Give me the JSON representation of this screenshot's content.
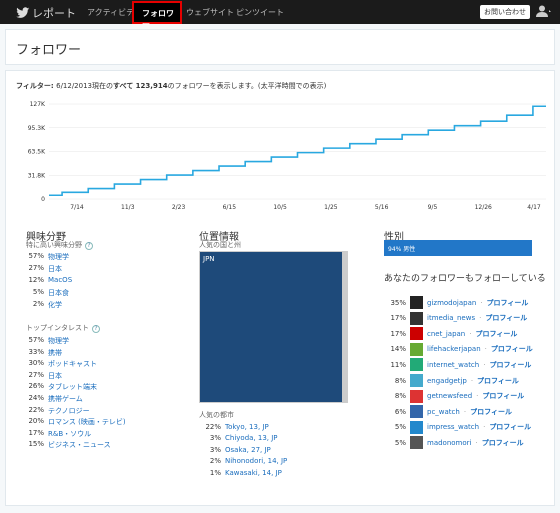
{
  "topbar": {
    "brand": "レポート",
    "nav": [
      "アクティビティ",
      "フォロワー",
      "ウェブサイト",
      "ピンツイート"
    ],
    "contact": "お問い合わせ"
  },
  "page_title": "フォロワー",
  "filter": {
    "label": "フィルター: ",
    "text_before": "6/12/2013現在の",
    "bold": "すべて 123,914",
    "text_after": "のフォロワーを表示します。(太平洋時間での表示)"
  },
  "chart_data": {
    "type": "line",
    "y_ticks": [
      "127K",
      "95.3K",
      "63.5K",
      "31.8K",
      "0"
    ],
    "x_ticks": [
      "7/14",
      "11/3",
      "2/23",
      "6/15",
      "10/5",
      "1/25",
      "5/16",
      "9/5",
      "12/26",
      "4/17"
    ],
    "ylim": [
      0,
      127000
    ],
    "color": "#29a8e0",
    "series": [
      {
        "values": [
          5000,
          9000,
          14000,
          20000,
          26000,
          32000,
          38000,
          44000,
          50000,
          56000,
          62000,
          68000,
          74000,
          80000,
          86000,
          92000,
          98000,
          104000,
          112000,
          124000
        ]
      }
    ]
  },
  "interests": {
    "title": "興味分野",
    "subtitle": "特に高い興味分野",
    "items": [
      {
        "pct": "57%",
        "label": "物理学"
      },
      {
        "pct": "27%",
        "label": "日本"
      },
      {
        "pct": "12%",
        "label": "MacOS"
      },
      {
        "pct": "5%",
        "label": "日本食"
      },
      {
        "pct": "2%",
        "label": "化学"
      }
    ],
    "top_title": "トップインタレスト",
    "top_items": [
      {
        "pct": "57%",
        "label": "物理学"
      },
      {
        "pct": "33%",
        "label": "携帯"
      },
      {
        "pct": "30%",
        "label": "ポッドキャスト"
      },
      {
        "pct": "27%",
        "label": "日本"
      },
      {
        "pct": "26%",
        "label": "タブレット端末"
      },
      {
        "pct": "24%",
        "label": "携帯ゲーム"
      },
      {
        "pct": "22%",
        "label": "テクノロジー"
      },
      {
        "pct": "20%",
        "label": "ロマンス (映画・テレビ)"
      },
      {
        "pct": "17%",
        "label": "R&B・ソウル"
      },
      {
        "pct": "15%",
        "label": "ビジネス・ニュース"
      }
    ]
  },
  "location": {
    "title": "位置情報",
    "subtitle": "人気の国と州",
    "country": "JPN",
    "cities_title": "人気の都市",
    "cities": [
      {
        "pct": "22%",
        "label": "Tokyo, 13, JP"
      },
      {
        "pct": "3%",
        "label": "Chiyoda, 13, JP"
      },
      {
        "pct": "3%",
        "label": "Osaka, 27, JP"
      },
      {
        "pct": "2%",
        "label": "Nihonodori, 14, JP"
      },
      {
        "pct": "1%",
        "label": "Kawasaki, 14, JP"
      }
    ]
  },
  "gender": {
    "title": "性別",
    "bar_label": "94% 男性",
    "male_fraction": 0.94
  },
  "also_follow": {
    "title": "あなたのフォロワーもフォローしている",
    "profile_label": "プロフィール",
    "items": [
      {
        "pct": "35%",
        "name": "gizmodojapan",
        "color": "#222"
      },
      {
        "pct": "17%",
        "name": "itmedia_news",
        "color": "#333"
      },
      {
        "pct": "17%",
        "name": "cnet_japan",
        "color": "#c00"
      },
      {
        "pct": "14%",
        "name": "lifehackerjapan",
        "color": "#6a3"
      },
      {
        "pct": "11%",
        "name": "internet_watch",
        "color": "#2a7"
      },
      {
        "pct": "8%",
        "name": "engadgetjp",
        "color": "#4ac"
      },
      {
        "pct": "8%",
        "name": "getnewsfeed",
        "color": "#d33"
      },
      {
        "pct": "6%",
        "name": "pc_watch",
        "color": "#36a"
      },
      {
        "pct": "5%",
        "name": "impress_watch",
        "color": "#28c"
      },
      {
        "pct": "5%",
        "name": "madonomori",
        "color": "#555"
      }
    ]
  }
}
